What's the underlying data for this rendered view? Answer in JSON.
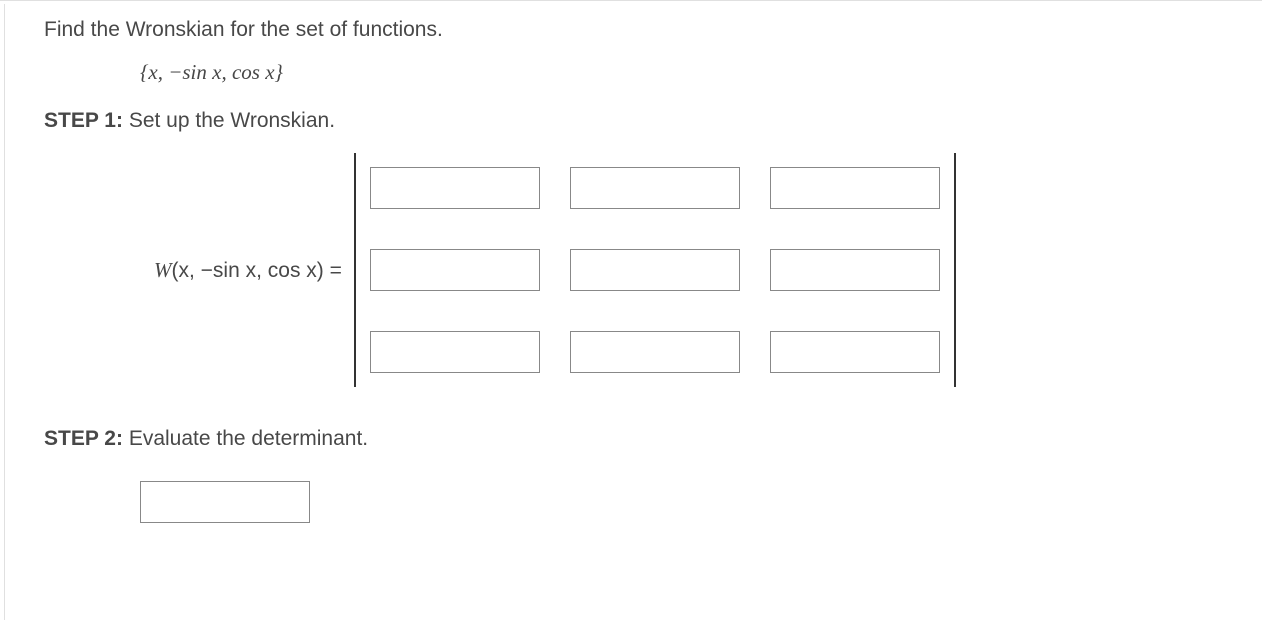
{
  "prompt": "Find the Wronskian for the set of functions.",
  "function_set": "{x, −sin x, cos x}",
  "step1": {
    "label": "STEP 1:",
    "text": " Set up the Wronskian."
  },
  "wronskian_label_pre": "W",
  "wronskian_label_args": "(x, −sin x, cos x) = ",
  "matrix": {
    "r0c0": "",
    "r0c1": "",
    "r0c2": "",
    "r1c0": "",
    "r1c1": "",
    "r1c2": "",
    "r2c0": "",
    "r2c1": "",
    "r2c2": ""
  },
  "step2": {
    "label": "STEP 2:",
    "text": " Evaluate the determinant."
  },
  "answer": ""
}
